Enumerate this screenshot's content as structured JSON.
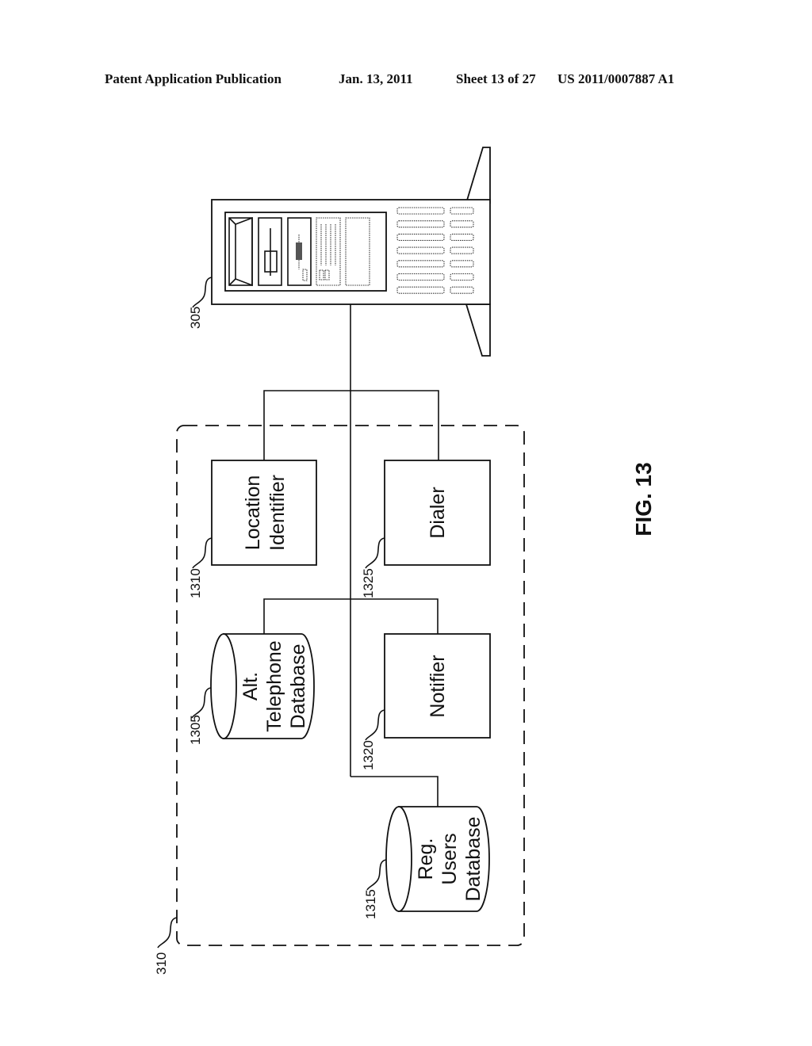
{
  "header": {
    "publication": "Patent Application Publication",
    "date": "Jan. 13, 2011",
    "sheet": "Sheet 13 of 27",
    "number": "US 2011/0007887 A1"
  },
  "figure": {
    "title": "FIG. 13",
    "server": {
      "ref": "305",
      "icon": "server-tower-icon"
    },
    "system": {
      "ref": "310"
    },
    "components": [
      {
        "id": "location-identifier",
        "ref": "1310",
        "shape": "box",
        "lines": [
          "Location",
          "Identifier"
        ]
      },
      {
        "id": "dialer",
        "ref": "1325",
        "shape": "box",
        "lines": [
          "Dialer"
        ]
      },
      {
        "id": "alt-telephone-database",
        "ref": "1305",
        "shape": "cylinder",
        "lines": [
          "Alt.",
          "Telephone",
          "Database"
        ]
      },
      {
        "id": "notifier",
        "ref": "1320",
        "shape": "box",
        "lines": [
          "Notifier"
        ]
      },
      {
        "id": "reg-users-database",
        "ref": "1315",
        "shape": "cylinder",
        "lines": [
          "Reg.",
          "Users",
          "Database"
        ]
      }
    ]
  }
}
